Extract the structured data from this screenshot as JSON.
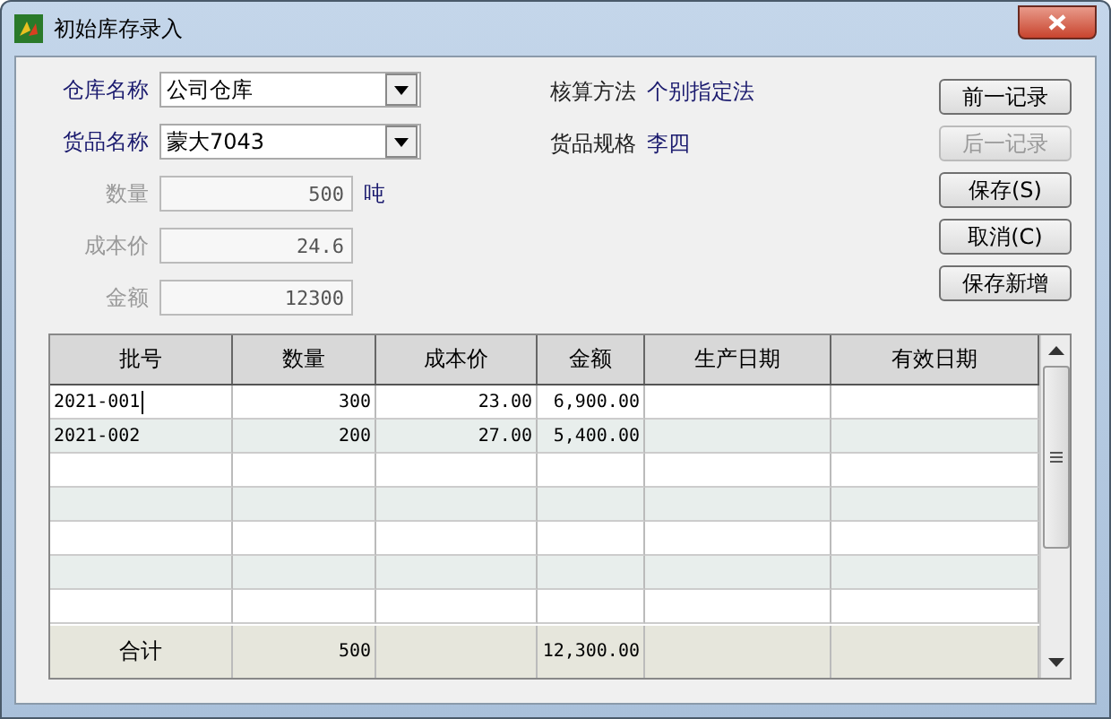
{
  "window": {
    "title": "初始库存录入"
  },
  "fields": [
    {
      "kind": "combo",
      "label": "仓库名称",
      "value": "公司仓库",
      "disabled": false
    },
    {
      "kind": "combo",
      "label": "货品名称",
      "value": "蒙大7043",
      "disabled": false
    },
    {
      "kind": "text",
      "label": "数量",
      "value": "500",
      "disabled": true,
      "unit": "吨"
    },
    {
      "kind": "text",
      "label": "成本价",
      "value": "24.6",
      "disabled": true
    },
    {
      "kind": "text",
      "label": "金额",
      "value": "12300",
      "disabled": true
    }
  ],
  "info": [
    {
      "label": "核算方法",
      "value": "个别指定法"
    },
    {
      "label": "货品规格",
      "value": "李四"
    }
  ],
  "buttons": [
    {
      "label": "前一记录",
      "disabled": false
    },
    {
      "label": "后一记录",
      "disabled": true
    },
    {
      "label": "保存(S)",
      "disabled": false
    },
    {
      "label": "取消(C)",
      "disabled": false
    },
    {
      "label": "保存新增",
      "disabled": false
    }
  ],
  "table": {
    "columns": [
      "批号",
      "数量",
      "成本价",
      "金额",
      "生产日期",
      "有效日期"
    ],
    "rows": [
      {
        "cells": [
          "2021-001",
          "300",
          "23.00",
          "6,900.00"
        ],
        "editing": true
      },
      {
        "cells": [
          "2021-002",
          "200",
          "27.00",
          "5,400.00"
        ],
        "editing": false
      }
    ],
    "total": {
      "label": "合计",
      "quantity": "500",
      "amount": "12,300.00"
    }
  }
}
